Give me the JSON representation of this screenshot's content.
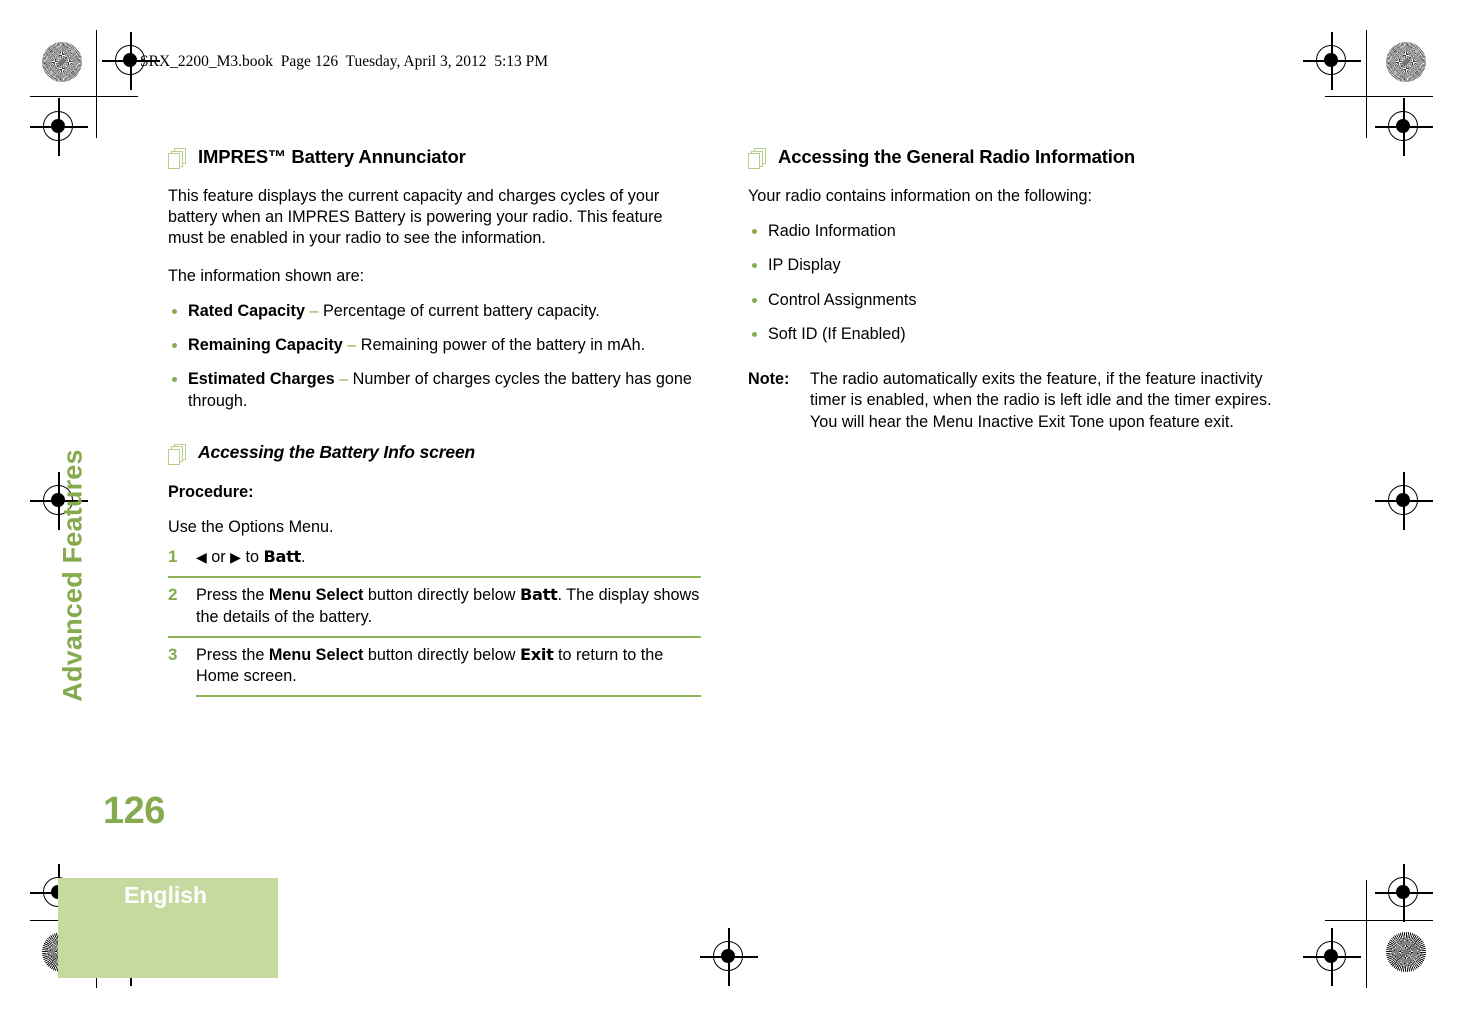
{
  "running_header": "SRX_2200_M3.book  Page 126  Tuesday, April 3, 2012  5:13 PM",
  "sidebar": {
    "chapter_label": "Advanced Features",
    "page_number": "126",
    "language_tab": "English"
  },
  "colors": {
    "accent_green": "#86ab4f",
    "rule_green": "#8fb457",
    "icon_green": "#b7cf8e",
    "tab_green": "#c6da9f",
    "tab_text": "#ffffff"
  },
  "left_column": {
    "heading": "IMPRES™ Battery Annunciator",
    "heading_icon": "stacked-pages-icon",
    "intro": "This feature displays the current capacity and charges cycles of your battery when an IMPRES Battery is powering your radio. This feature must be enabled in your radio to see the information.",
    "list_lead": "The information shown are:",
    "definitions": [
      {
        "term": "Rated Capacity",
        "dash": "–",
        "description": "Percentage of current  battery capacity."
      },
      {
        "term": "Remaining Capacity",
        "dash": "–",
        "description": "Remaining power of the battery in mAh."
      },
      {
        "term": "Estimated Charges",
        "dash": "–",
        "description": "Number of charges cycles the battery has gone through."
      }
    ],
    "subheading": "Accessing the Battery Info screen",
    "subheading_icon": "stacked-pages-icon",
    "procedure_label": "Procedure:",
    "procedure_intro": "Use the Options Menu.",
    "steps": [
      {
        "number": "1",
        "prefix": "",
        "arrow_left": "◀",
        "or_word": " or ",
        "arrow_right": "▶",
        "middle": " to ",
        "code": "Batt",
        "suffix": "."
      },
      {
        "number": "2",
        "pre": "Press the ",
        "button": "Menu Select",
        "mid": " button directly below ",
        "code": "Batt",
        "post": ". The display shows the details of the battery."
      },
      {
        "number": "3",
        "pre": "Press the ",
        "button": "Menu Select",
        "mid": " button directly below ",
        "code": "Exit",
        "post": " to return to the Home screen."
      }
    ]
  },
  "right_column": {
    "heading": "Accessing the General Radio Information",
    "heading_icon": "stacked-pages-icon",
    "intro": "Your radio contains information on the following:",
    "bullets": [
      "Radio Information",
      "IP Display",
      "Control Assignments",
      "Soft ID (If Enabled)"
    ],
    "note": {
      "label": "Note:",
      "text": "The radio automatically exits the feature, if the feature inactivity timer is enabled, when the radio is left idle and the timer expires. You will hear the Menu Inactive Exit Tone upon feature exit."
    }
  }
}
